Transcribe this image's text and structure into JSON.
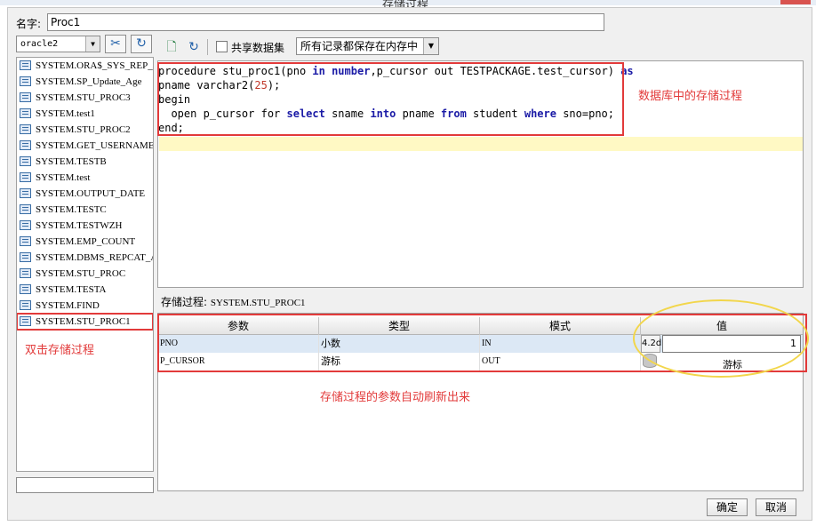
{
  "window": {
    "title": "存储过程"
  },
  "name_field": {
    "label": "名字:",
    "value": "Proc1"
  },
  "connection": {
    "selected": "oracle2"
  },
  "procedures": [
    "SYSTEM.ORA$_SYS_REP_AUTH",
    "SYSTEM.SP_Update_Age",
    "SYSTEM.STU_PROC3",
    "SYSTEM.test1",
    "SYSTEM.STU_PROC2",
    "SYSTEM.GET_USERNAME",
    "SYSTEM.TESTB",
    "SYSTEM.test",
    "SYSTEM.OUTPUT_DATE",
    "SYSTEM.TESTC",
    "SYSTEM.TESTWZH",
    "SYSTEM.EMP_COUNT",
    "SYSTEM.DBMS_REPCAT_AUTH",
    "SYSTEM.STU_PROC",
    "SYSTEM.TESTA",
    "SYSTEM.FIND",
    "SYSTEM.STU_PROC1"
  ],
  "toolbar": {
    "share_label": "共享数据集",
    "mode_selected": "所有记录都保存在内存中"
  },
  "code": {
    "line1_a": "procedure stu_proc1(pno ",
    "line1_in": "in",
    "line1_sp1": " ",
    "line1_number": "number",
    "line1_b": ",p_cursor out TESTPACKAGE.test_cursor) ",
    "line1_as": "as",
    "line2_a": "pname varchar2(",
    "line2_num": "25",
    "line2_b": ");",
    "line3": "begin",
    "line4_a": "  open p_cursor for ",
    "line4_select": "select",
    "line4_b": " sname ",
    "line4_into": "into",
    "line4_c": " pname ",
    "line4_from": "from",
    "line4_d": " student ",
    "line4_where": "where",
    "line4_e": " sno=pno;",
    "line5": "end;"
  },
  "annotations": {
    "db_proc": "数据库中的存储过程",
    "dbl_click": "双击存储过程",
    "auto_refresh": "存储过程的参数自动刷新出来"
  },
  "proc_name": {
    "label": "存储过程:",
    "value": "SYSTEM.STU_PROC1"
  },
  "params": {
    "headers": [
      "参数",
      "类型",
      "模式",
      "值"
    ],
    "rows": [
      {
        "name": "PNO",
        "type": "小数",
        "mode": "IN",
        "value_btn": "4.2d",
        "value": "1"
      },
      {
        "name": "P_CURSOR",
        "type": "游标",
        "mode": "OUT",
        "value": "游标"
      }
    ]
  },
  "buttons": {
    "ok": "确定",
    "cancel": "取消"
  }
}
